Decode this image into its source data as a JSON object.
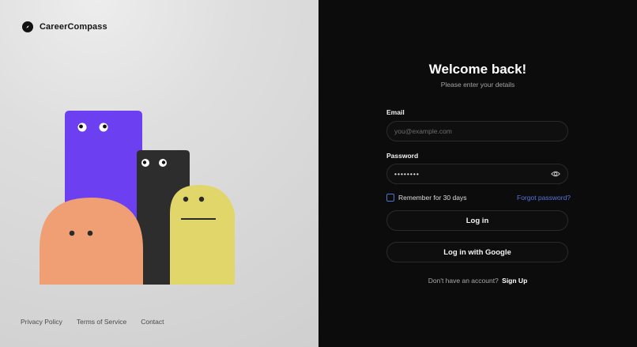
{
  "brand": {
    "name": "CareerCompass"
  },
  "footer": {
    "links": [
      "Privacy Policy",
      "Terms of Service",
      "Contact"
    ]
  },
  "login": {
    "title": "Welcome back!",
    "subtitle": "Please enter your details",
    "email_label": "Email",
    "email_placeholder": "you@example.com",
    "password_label": "Password",
    "password_value": "••••••••",
    "remember_label": "Remember for 30 days",
    "forgot_label": "Forgot password?",
    "login_button": "Log in",
    "google_button": "Log in with Google",
    "no_account_text": "Don't have an account?",
    "signup_link": "Sign Up"
  },
  "colors": {
    "accent_link": "#5875db",
    "purple_character": "#6c3ff0",
    "dark_character": "#2d2d2d",
    "yellow_character": "#e1d66a",
    "orange_character": "#ef9f73"
  },
  "icons": {
    "logo": "compass-icon",
    "password_toggle": "eye-icon"
  }
}
